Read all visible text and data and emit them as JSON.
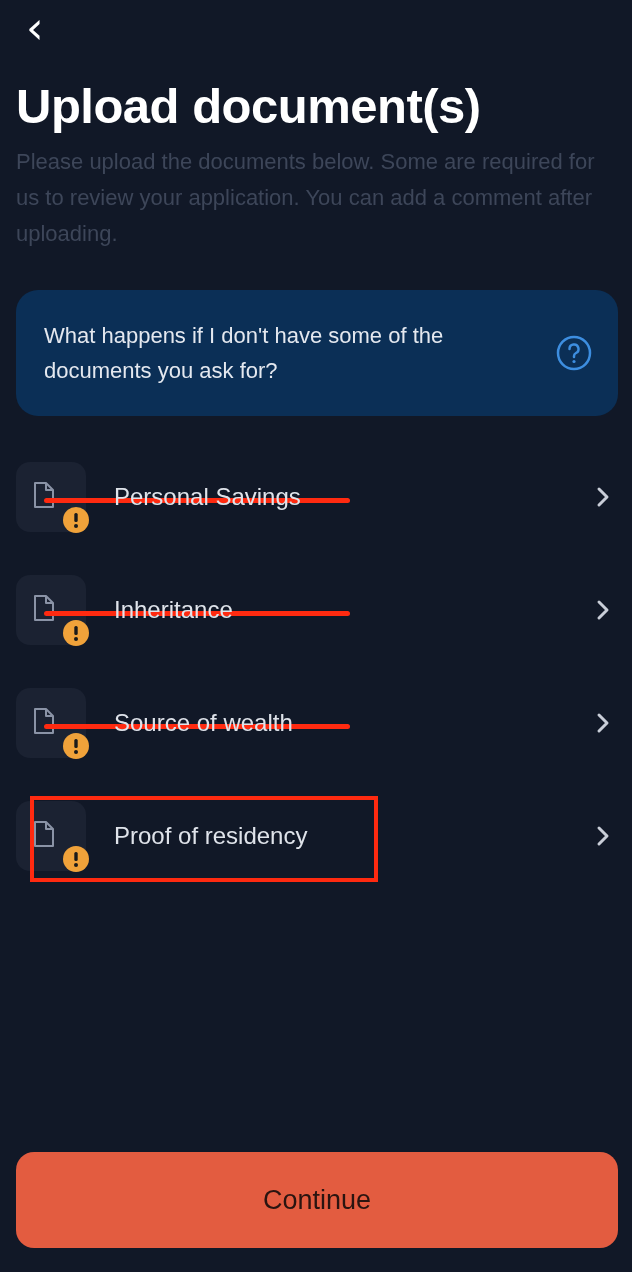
{
  "header": {
    "back": "‹"
  },
  "title": "Upload document(s)",
  "description": "Please upload the documents below. Some are required for us to review your application. You can add a comment after uploading.",
  "info_card": {
    "text": "What happens if I don't have some of the documents you ask for?"
  },
  "documents": [
    {
      "label": "Personal Savings",
      "warning": true,
      "struck_out": true,
      "boxed": false
    },
    {
      "label": "Inheritance",
      "warning": true,
      "struck_out": true,
      "boxed": false
    },
    {
      "label": "Source of wealth",
      "warning": true,
      "struck_out": true,
      "boxed": false
    },
    {
      "label": "Proof of residency",
      "warning": true,
      "struck_out": false,
      "boxed": true
    }
  ],
  "continue_button": {
    "label": "Continue"
  }
}
